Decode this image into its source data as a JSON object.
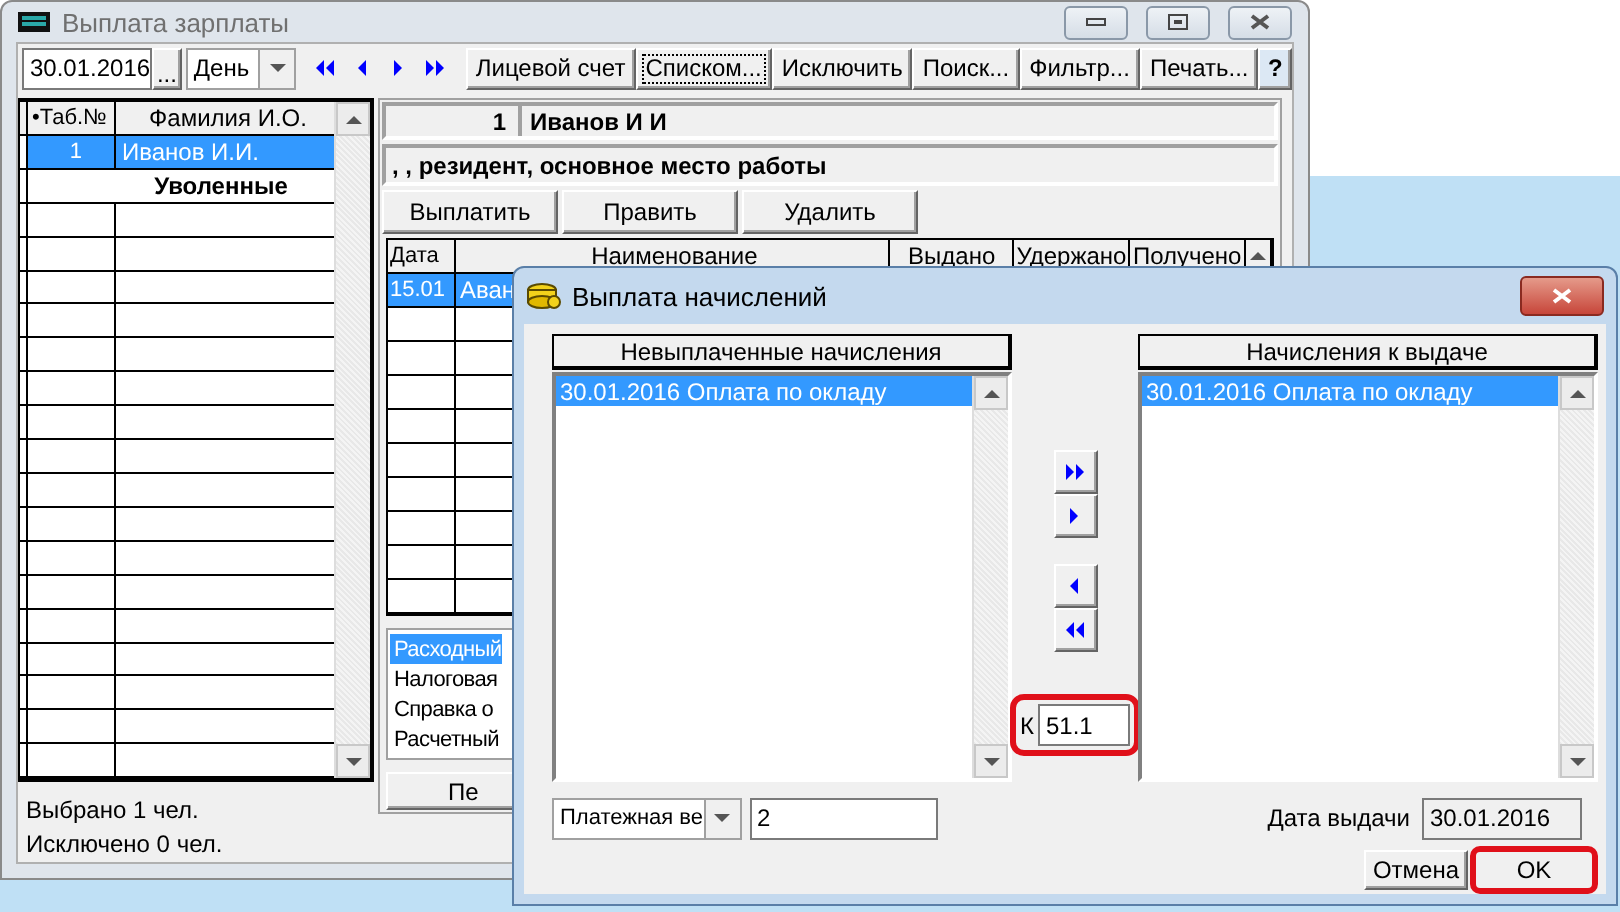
{
  "main_window": {
    "title": "Выплата зарплаты",
    "date": "30.01.2016",
    "browse_button": "...",
    "period": "День",
    "toolbar_buttons": [
      {
        "label": "Лицевой счет",
        "focused": false
      },
      {
        "label": "Списком...",
        "focused": true
      },
      {
        "label": "Исключить",
        "focused": false
      },
      {
        "label": "Поиск...",
        "focused": false
      },
      {
        "label": "Фильтр...",
        "focused": false
      },
      {
        "label": "Печать...",
        "focused": false
      },
      {
        "label": "?",
        "focused": false
      }
    ],
    "employees": {
      "columns": [
        "•Таб.№",
        "Фамилия И.О."
      ],
      "rows": [
        {
          "kind": "employee",
          "number": "1",
          "name": "Иванов И.И.",
          "selected": true
        },
        {
          "kind": "group",
          "name": "Уволенные",
          "selected": false
        }
      ]
    },
    "status": [
      "Выбрано 1 чел.",
      "Исключено 0 чел."
    ],
    "employee_header": {
      "number": "1",
      "name": "Иванов И И"
    },
    "employee_info": ", , резидент, основное место работы",
    "actions": [
      "Выплатить",
      "Править",
      "Удалить"
    ],
    "payments": {
      "columns": [
        "Дата",
        "Наименование",
        "Выдано",
        "Удержано",
        "Получено"
      ],
      "rows": [
        {
          "date": "15.01",
          "name": "Аван",
          "selected": true
        }
      ]
    },
    "reports": [
      {
        "label": "Расходный",
        "selected": true
      },
      {
        "label": "Налоговая",
        "selected": false
      },
      {
        "label": "Справка о",
        "selected": false
      },
      {
        "label": "Расчетный",
        "selected": false
      }
    ],
    "report_button": "Пе"
  },
  "dialog": {
    "title": "Выплата начислений",
    "unpaid": {
      "header": "Невыплаченные начисления",
      "items": [
        {
          "label": "30.01.2016 Оплата по окладу",
          "selected": true
        }
      ]
    },
    "to_pay": {
      "header": "Начисления к выдаче",
      "items": [
        {
          "label": "30.01.2016 Оплата по окладу",
          "selected": true
        }
      ]
    },
    "account_label": "К",
    "account": "51.1",
    "account_highlighted": true,
    "document_type": "Платежная ве",
    "document_number": "2",
    "date_label": "Дата выдачи",
    "date": "30.01.2016",
    "buttons": [
      {
        "label": "Отмена",
        "highlighted": false
      },
      {
        "label": "OK",
        "highlighted": true
      }
    ]
  }
}
